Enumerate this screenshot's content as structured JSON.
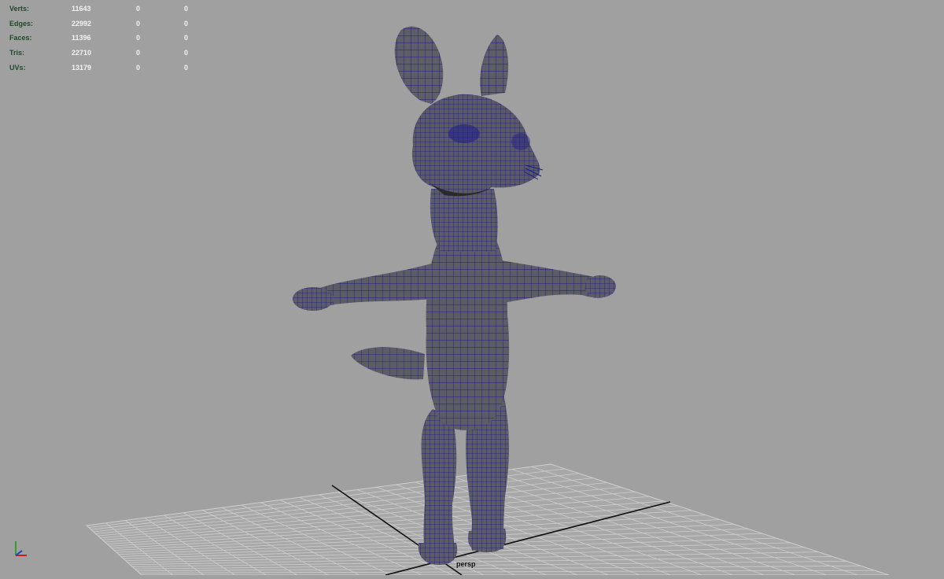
{
  "hud": {
    "rows": [
      {
        "label": "Verts:",
        "v1": "11643",
        "v2": "0",
        "v3": "0"
      },
      {
        "label": "Edges:",
        "v1": "22992",
        "v2": "0",
        "v3": "0"
      },
      {
        "label": "Faces:",
        "v1": "11396",
        "v2": "0",
        "v3": "0"
      },
      {
        "label": "Tris:",
        "v1": "22710",
        "v2": "0",
        "v3": "0"
      },
      {
        "label": "UVs:",
        "v1": "13179",
        "v2": "0",
        "v3": "0"
      }
    ]
  },
  "viewport": {
    "camera_label": "persp",
    "background_color": "#a0a0a0",
    "wireframe_color": "#1c1c8a",
    "mesh_color": "#5c5c66",
    "grid_color": "#c8c8c8",
    "axis_icon": "axis-gizmo-icon"
  }
}
